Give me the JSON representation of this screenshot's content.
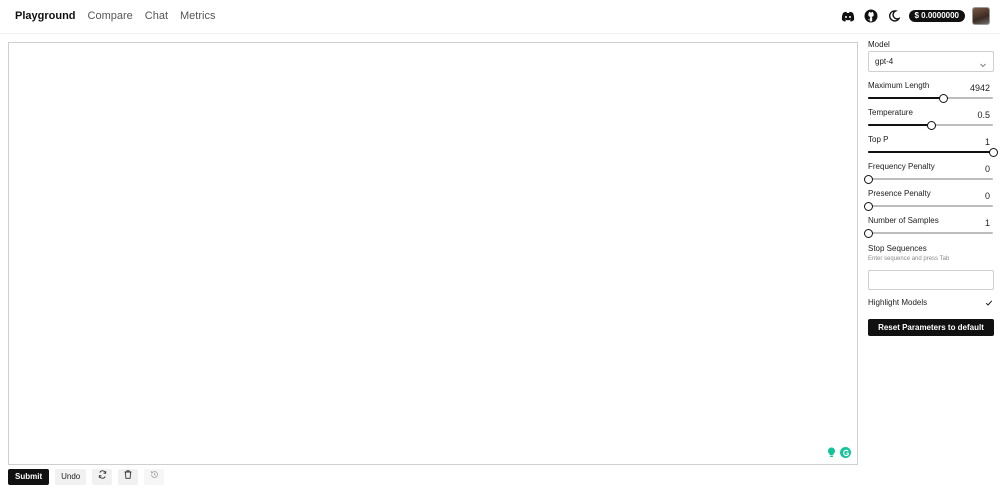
{
  "nav": {
    "items": [
      {
        "label": "Playground",
        "active": true
      },
      {
        "label": "Compare",
        "active": false
      },
      {
        "label": "Chat",
        "active": false
      },
      {
        "label": "Metrics",
        "active": false
      }
    ]
  },
  "header": {
    "icons": [
      "discord-icon",
      "github-icon",
      "moon-icon"
    ],
    "credits": "$ 0.0000000"
  },
  "editor": {
    "value": "",
    "icons": [
      "lightbulb-icon",
      "grammarly-icon"
    ],
    "colors": {
      "accent": "#15c39a"
    }
  },
  "toolbar": {
    "submit_label": "Submit",
    "undo_label": "Undo",
    "icons": [
      "regenerate-icon",
      "trash-icon",
      "history-icon"
    ]
  },
  "settings": {
    "model_label": "Model",
    "model_value": "gpt-4",
    "params": [
      {
        "name": "maximum-length",
        "label": "Maximum Length",
        "value": "4942",
        "position": 0.6
      },
      {
        "name": "temperature",
        "label": "Temperature",
        "value": "0.5",
        "position": 0.5
      },
      {
        "name": "top-p",
        "label": "Top P",
        "value": "1",
        "position": 1.0
      },
      {
        "name": "frequency-penalty",
        "label": "Frequency Penalty",
        "value": "0",
        "position": 0.0
      },
      {
        "name": "presence-penalty",
        "label": "Presence Penalty",
        "value": "0",
        "position": 0.0
      },
      {
        "name": "number-of-samples",
        "label": "Number of Samples",
        "value": "1",
        "position": 0.0
      }
    ],
    "stop_label": "Stop Sequences",
    "stop_help": "Enter sequence and press Tab",
    "stop_value": "",
    "highlight_label": "Highlight Models",
    "highlight_checked": true,
    "reset_label": "Reset Parameters to default"
  }
}
